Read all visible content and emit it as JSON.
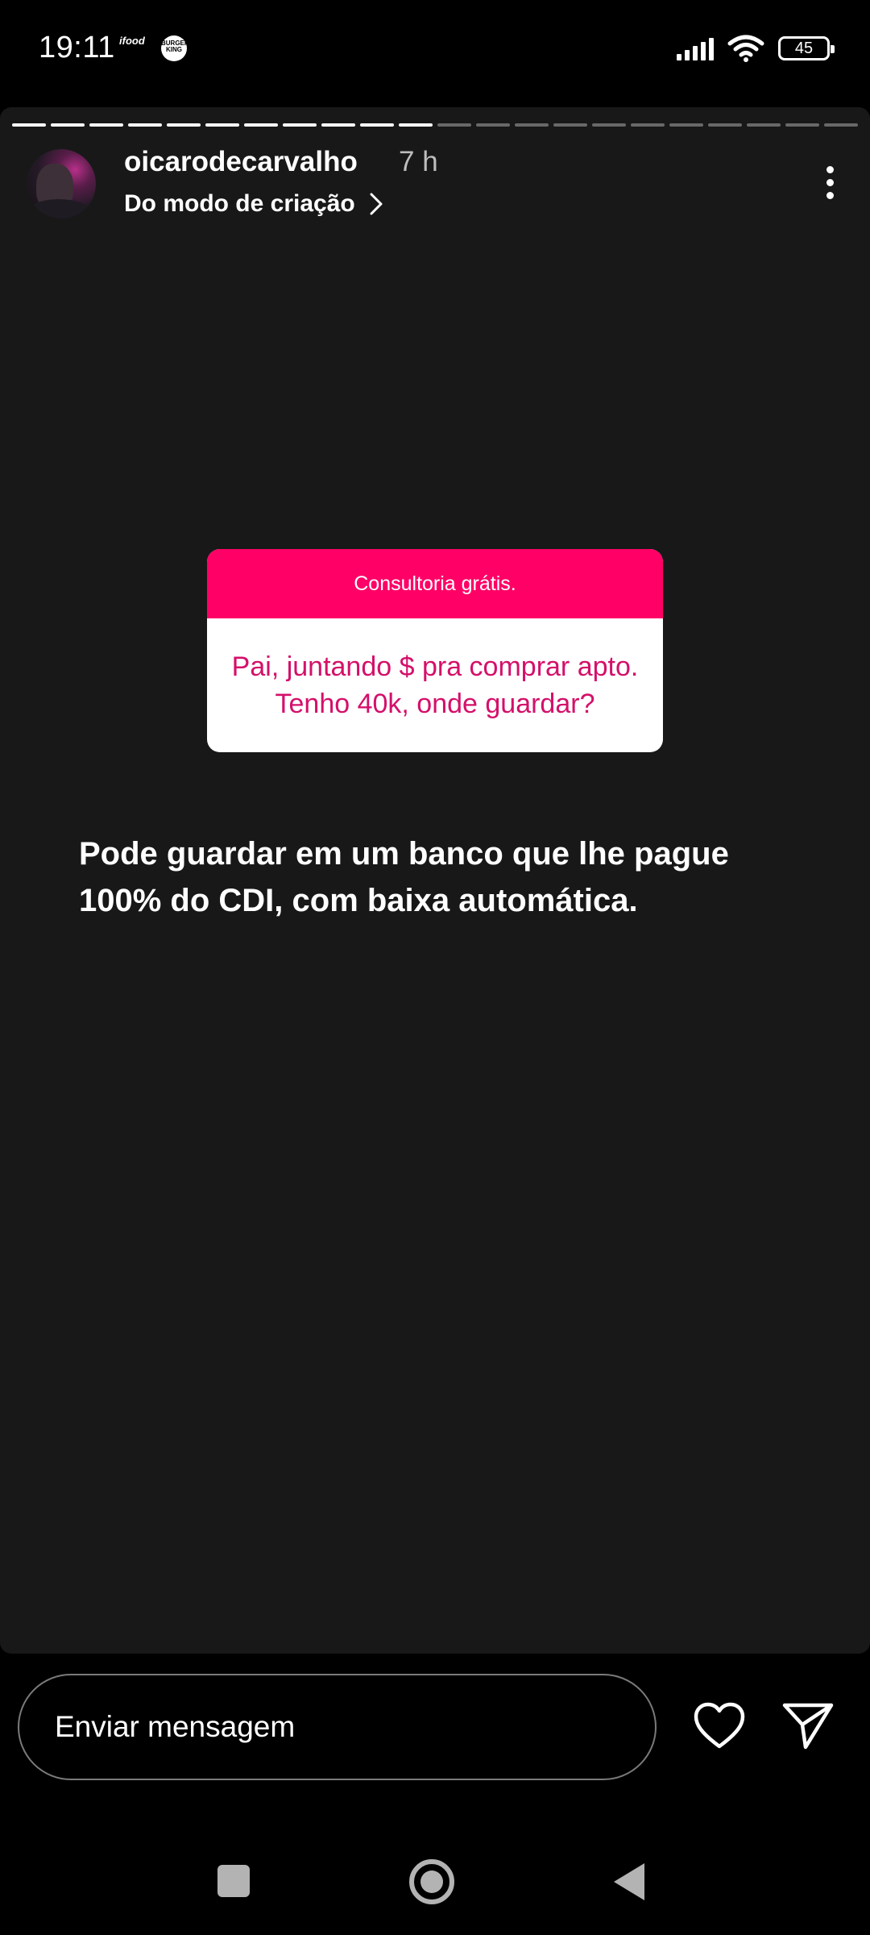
{
  "status_bar": {
    "time": "19:11",
    "app_icons": [
      "ifood",
      "BURGER KING"
    ],
    "battery": "45"
  },
  "story": {
    "progress": {
      "total_segments": 22,
      "completed_segments": 11
    },
    "header": {
      "username": "oicarodecarvalho",
      "time_ago": "7 h",
      "subtitle": "Do modo de criação"
    },
    "question_sticker": {
      "header": "Consultoria grátis.",
      "question": "Pai, juntando $ pra comprar apto. Tenho 40k, onde guardar?",
      "accent_color": "#ff0066"
    },
    "answer": "Pode guardar em um banco que lhe pague 100% do CDI, com baixa automática."
  },
  "message_bar": {
    "placeholder": "Enviar mensagem"
  },
  "icons": {
    "more": "more-vertical-icon",
    "heart": "heart-icon",
    "send": "send-icon",
    "chevron": "chevron-right-icon"
  }
}
